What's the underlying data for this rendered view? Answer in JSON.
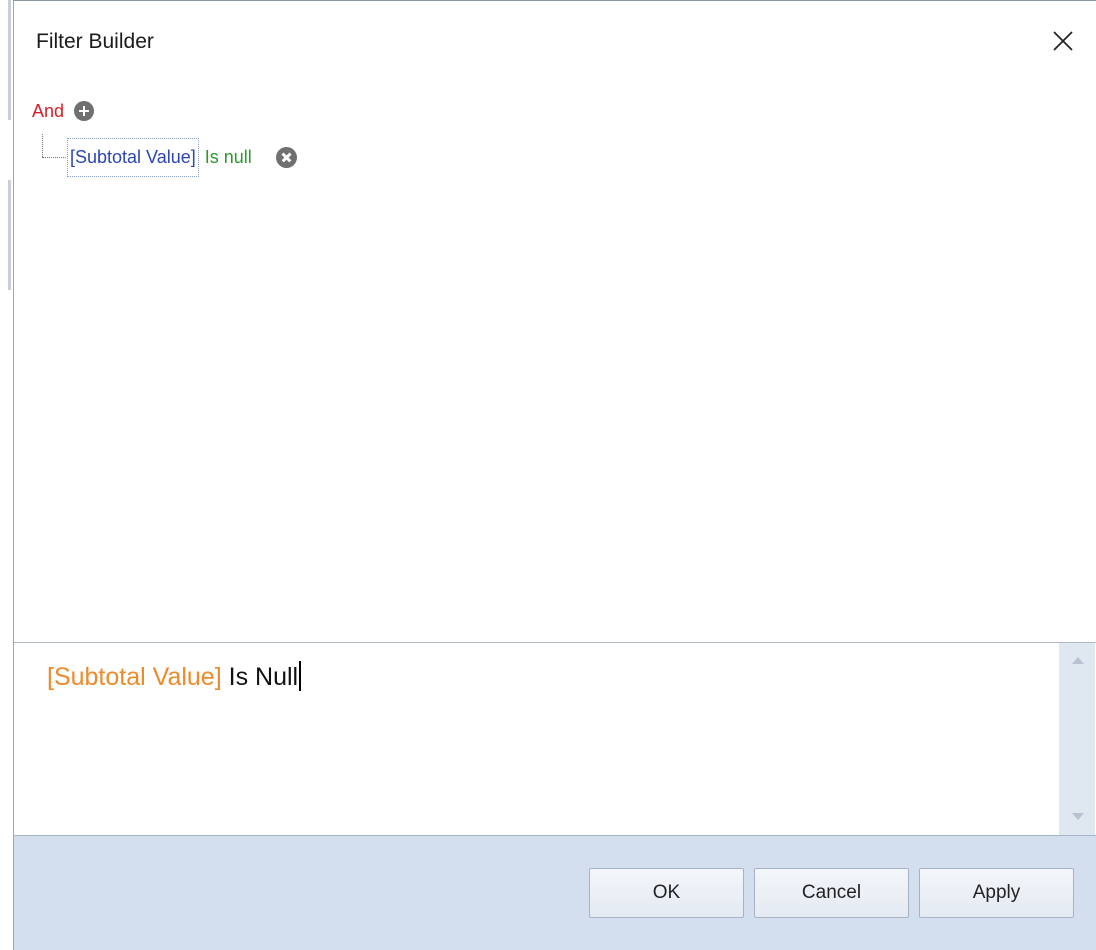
{
  "dialog": {
    "title": "Filter Builder",
    "close_icon": "close-icon"
  },
  "tree": {
    "group_operator": "And",
    "add_icon": "plus-circle-icon",
    "conditions": [
      {
        "field": "[Subtotal Value]",
        "operator": "Is null",
        "remove_icon": "remove-circle-icon"
      }
    ]
  },
  "editor": {
    "field_text": "[Subtotal Value]",
    "operator_text": "Is Null"
  },
  "buttons": {
    "ok": "OK",
    "cancel": "Cancel",
    "apply": "Apply"
  },
  "colors": {
    "group_operator": "#d61f2b",
    "field": "#2a45b5",
    "operator": "#2d9a2d",
    "editor_field": "#ef8a2a",
    "footer_background": "#d3dfef"
  }
}
